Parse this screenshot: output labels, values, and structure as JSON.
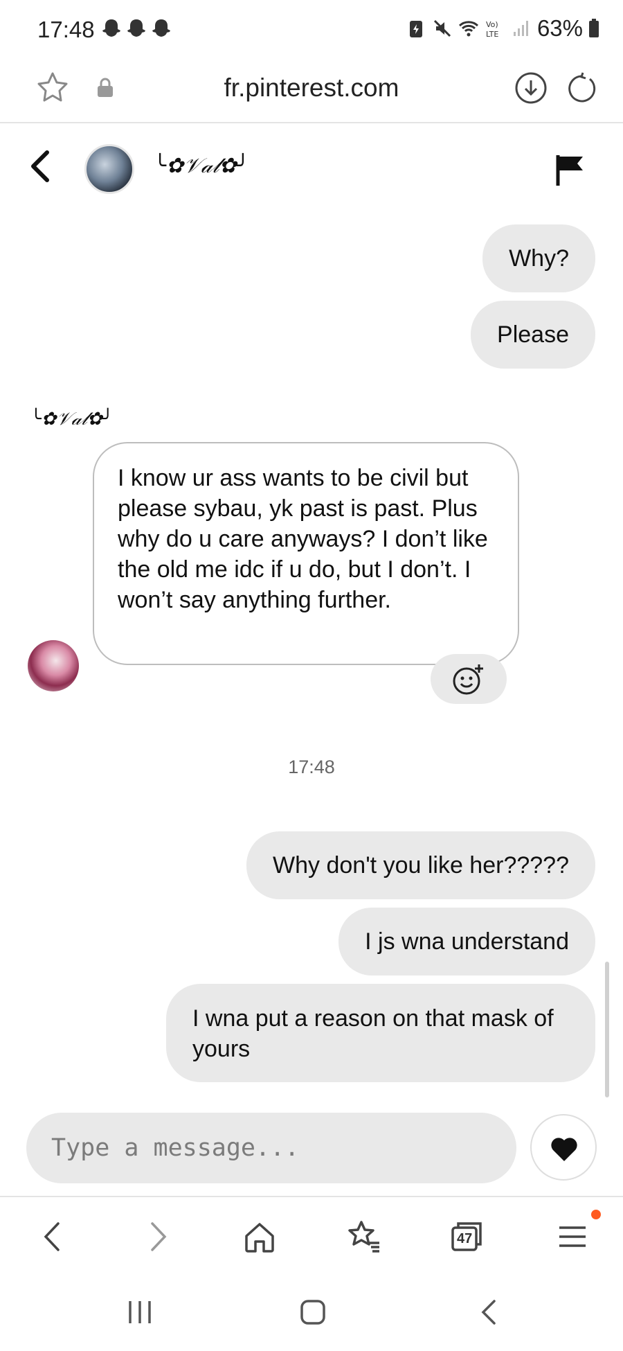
{
  "status_bar": {
    "time": "17:48",
    "battery": "63%",
    "icons": [
      "snapchat-icon",
      "snapchat-icon",
      "snapchat-icon",
      "battery-saver-icon",
      "mute-icon",
      "wifi-icon",
      "volte-icon",
      "signal-icon",
      "battery-icon"
    ]
  },
  "browser": {
    "url": "fr.pinterest.com",
    "tab_count": "47",
    "icons": [
      "star-icon",
      "lock-icon",
      "download-icon",
      "reload-icon",
      "back-icon",
      "forward-icon",
      "home-icon",
      "bookmarks-icon",
      "tabs-icon",
      "menu-icon"
    ]
  },
  "chat": {
    "contact_name": "╰✿𝒱𝒶𝓁✿╯",
    "messages": [
      {
        "from": "me",
        "text": "Why?"
      },
      {
        "from": "me",
        "text": "Please"
      },
      {
        "from": "other",
        "sender": "╰✿𝒱𝒶𝓁✿╯",
        "text": "I know ur ass wants to be civil but please sybau, yk past is past. Plus why do u care anyways? I don’t like the old me idc if u do, but I don’t. I won’t say anything further."
      },
      {
        "from": "me",
        "text": "Why don't you like her?????"
      },
      {
        "from": "me",
        "text": "I js wna understand"
      },
      {
        "from": "me",
        "text": "I wna put a reason on that mask of yours"
      }
    ],
    "timestamp": "17:48"
  },
  "composer": {
    "placeholder": "Type a message...",
    "value": ""
  },
  "colors": {
    "bubble_me": "#e9e9e9",
    "accent_dot": "#ff5a1f"
  }
}
